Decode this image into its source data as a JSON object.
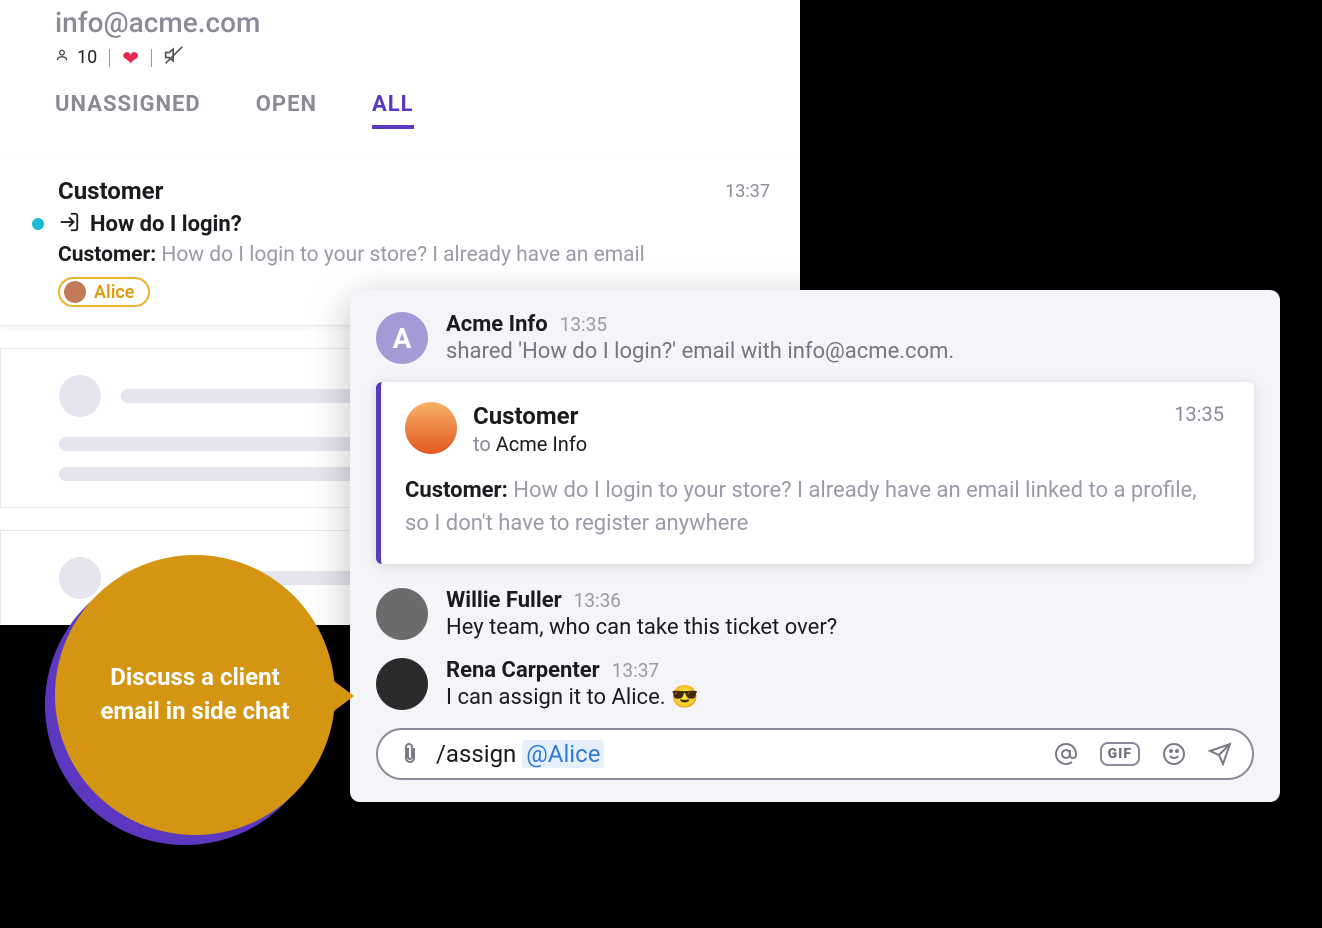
{
  "header": {
    "title": "info@acme.com",
    "people_count": "10"
  },
  "tabs": {
    "unassigned": "UNASSIGNED",
    "open": "OPEN",
    "all": "ALL"
  },
  "ticket": {
    "customer": "Customer",
    "time": "13:37",
    "subject": "How do I login?",
    "preview_from": "Customer:",
    "preview_text": " How do I login to your store? I already have an email",
    "assignee": "Alice"
  },
  "badge": {
    "text": "Discuss a client email in side chat"
  },
  "chat": {
    "share_event": {
      "name": "Acme Info",
      "time": "13:35",
      "text_prefix": "shared ",
      "subject": "'How do I login?'",
      "text_mid": " email with ",
      "recipient": "info@acme.com",
      "text_suffix": "."
    },
    "email": {
      "from": "Customer",
      "to_label": "to ",
      "to": "Acme Info",
      "time": "13:35",
      "body_from": "Customer:",
      "body_text": " How do I login to your store? I already have an email linked to a profile, so I don't have to register anywhere"
    },
    "messages": [
      {
        "name": "Willie Fuller",
        "time": "13:36",
        "text": "Hey team, who can take this ticket over?"
      },
      {
        "name": "Rena Carpenter",
        "time": "13:37",
        "text": "I can assign it to Alice. 😎"
      }
    ],
    "composer": {
      "command": "/assign ",
      "mention": "@Alice",
      "gif_label": "GIF"
    }
  }
}
